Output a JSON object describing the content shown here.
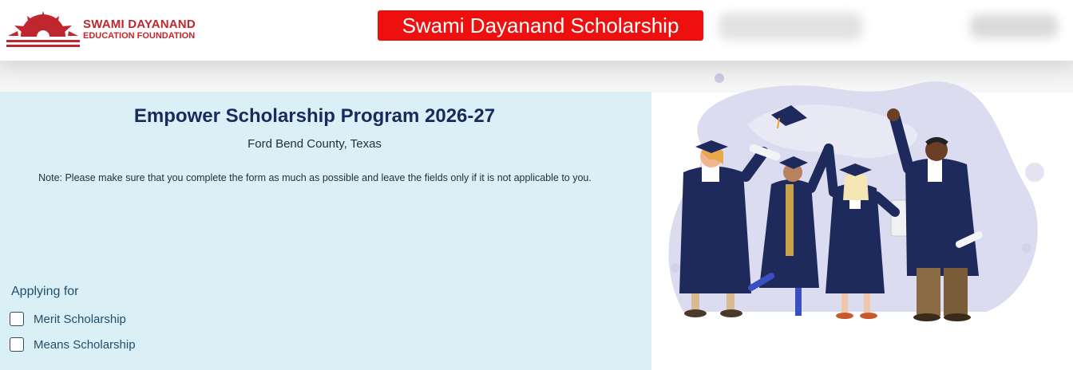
{
  "header": {
    "logo": {
      "line1": "SWAMI DAYANAND",
      "line2": "EDUCATION FOUNDATION"
    },
    "title": "Swami Dayanand Scholarship"
  },
  "form": {
    "title": "Empower Scholarship Program 2026-27",
    "subtitle": "Ford Bend County, Texas",
    "note": "Note: Please make sure that you complete the form as much as possible and leave the fields only if it is not applicable to you.",
    "applying_for": {
      "label": "Applying for",
      "options": [
        {
          "label": "Merit Scholarship",
          "checked": false
        },
        {
          "label": "Means Scholarship",
          "checked": false
        }
      ]
    }
  },
  "colors": {
    "brand_red": "#c0262d",
    "title_red": "#ee0f0f",
    "panel_bg": "#dbeff7",
    "gown_navy": "#1f2a5c"
  }
}
